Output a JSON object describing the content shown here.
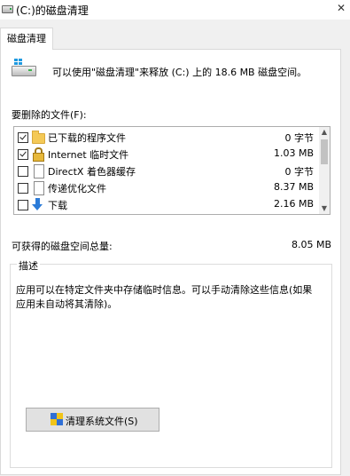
{
  "window": {
    "title": "(C:)的磁盘清理",
    "close_glyph": "✕"
  },
  "tab": {
    "label": "磁盘清理"
  },
  "summary": {
    "text": "可以使用\"磁盘清理\"来释放  (C:) 上的 18.6 MB 磁盘空间。"
  },
  "files_label": "要删除的文件(F):",
  "file_list": [
    {
      "name": "已下载的程序文件",
      "size": "0 字节",
      "checked": true,
      "icon": "folder-icon"
    },
    {
      "name": "Internet 临时文件",
      "size": "1.03 MB",
      "checked": true,
      "icon": "lock-icon"
    },
    {
      "name": "DirectX 着色器缓存",
      "size": "0 字节",
      "checked": false,
      "icon": "document-icon"
    },
    {
      "name": "传递优化文件",
      "size": "8.37 MB",
      "checked": false,
      "icon": "document-icon"
    },
    {
      "name": "下载",
      "size": "2.16 MB",
      "checked": false,
      "icon": "download-arrow-icon"
    }
  ],
  "total": {
    "label": "可获得的磁盘空间总量:",
    "value": "8.05 MB"
  },
  "description": {
    "title": "描述",
    "text": "应用可以在特定文件夹中存储临时信息。可以手动清除这些信息(如果应用未自动将其清除)。"
  },
  "cleanup_button": {
    "label": "清理系统文件(S)",
    "icon": "uac-shield-icon"
  },
  "colors": {
    "window_bg": "#f0f0f0",
    "panel_bg": "#ffffff",
    "button_bg": "#e1e1e1"
  }
}
